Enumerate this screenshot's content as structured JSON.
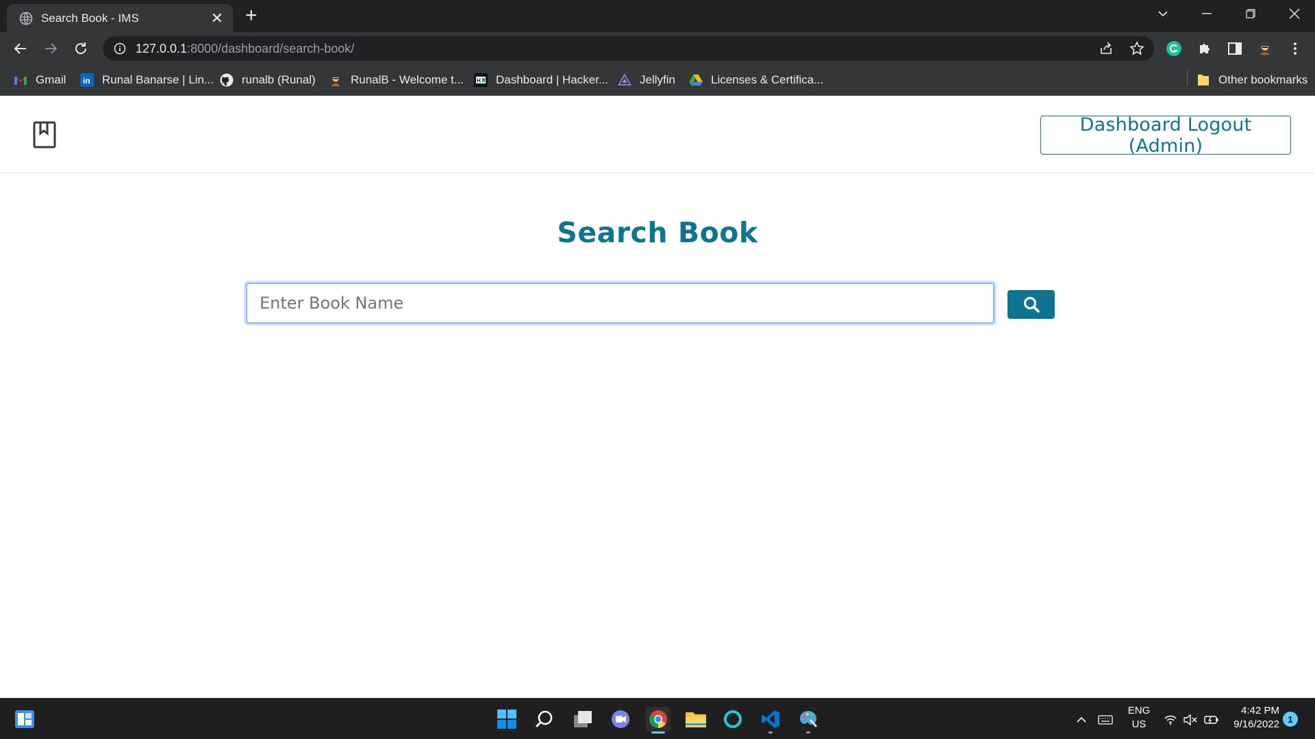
{
  "browser": {
    "tab": {
      "title": "Search Book - IMS",
      "icon": "globe-icon"
    },
    "url": {
      "host": "127.0.0.1",
      "path": ":8000/dashboard/search-book/"
    },
    "bookmarks": [
      {
        "label": "Gmail",
        "icon": "gmail-icon"
      },
      {
        "label": "Runal Banarse | Lin...",
        "icon": "linkedin-icon"
      },
      {
        "label": "runalb (Runal)",
        "icon": "github-icon"
      },
      {
        "label": "RunalB - Welcome t...",
        "icon": "avatar-icon"
      },
      {
        "label": "Dashboard | Hacker...",
        "icon": "hackerrank-icon"
      },
      {
        "label": "Jellyfin",
        "icon": "jellyfin-icon"
      },
      {
        "label": "Licenses & Certifica...",
        "icon": "google-drive-icon"
      }
    ],
    "other_bookmarks": "Other bookmarks"
  },
  "header": {
    "logout_label": "Dashboard Logout (Admin)"
  },
  "main": {
    "title": "Search Book",
    "search_placeholder": "Enter Book Name"
  },
  "taskbar": {
    "lang": "ENG",
    "region": "US",
    "time": "4:42 PM",
    "date": "9/16/2022",
    "notification_count": "1"
  },
  "colors": {
    "accent": "#0e7490",
    "focus": "#86b7fe",
    "chrome_dark": "#202124",
    "chrome": "#35363a"
  }
}
